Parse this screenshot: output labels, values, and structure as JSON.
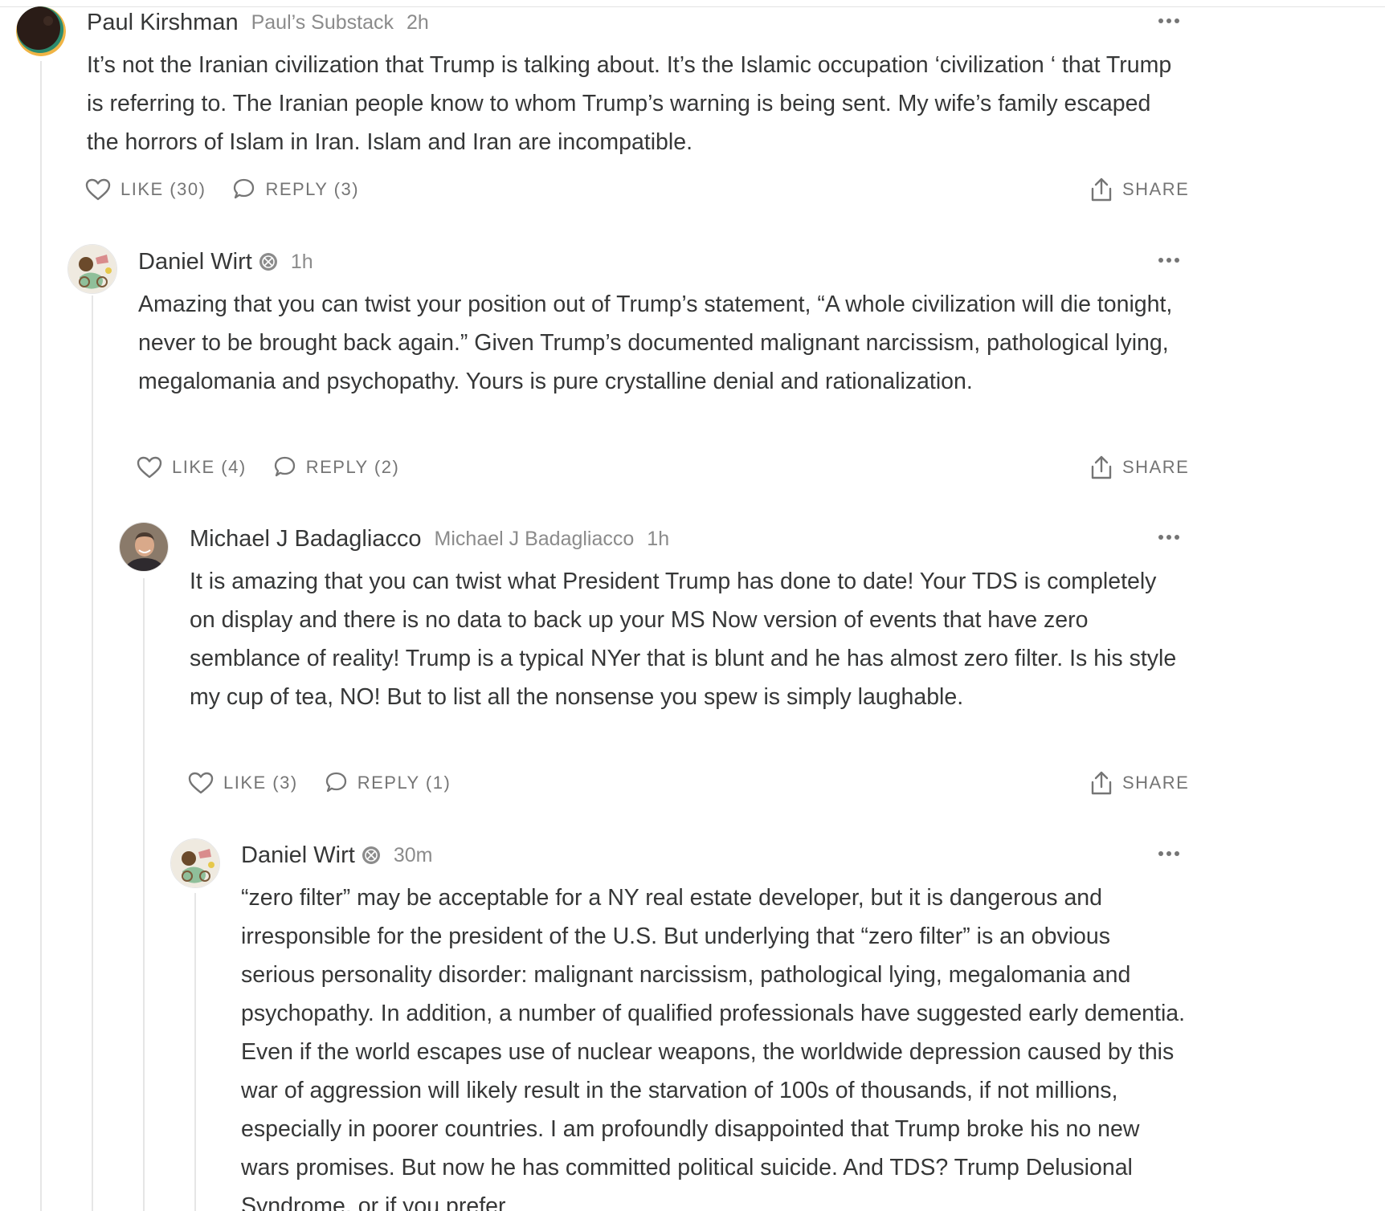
{
  "comments": [
    {
      "author": "Paul Kirshman",
      "publication": "Paul’s Substack",
      "time": "2h",
      "text": "It’s not the Iranian civilization that Trump is talking about. It’s the Islamic occupation ‘civilization ‘ that Trump is referring to. The Iranian people know to whom Trump’s warning is being sent. My wife’s family escaped the horrors of Islam in Iran. Islam and Iran are incompatible.",
      "like_label": "LIKE (30)",
      "reply_label": "REPLY (3)",
      "share_label": "SHARE"
    },
    {
      "author": "Daniel Wirt",
      "time": "1h",
      "text": "Amazing that you can twist your position out of Trump’s statement, “A whole civilization will die tonight, never to be brought back again.” Given Trump’s documented malignant narcissism, pathological lying, megalomania and psychopathy. Yours is pure crystalline denial and rationalization.",
      "like_label": "LIKE (4)",
      "reply_label": "REPLY (2)",
      "share_label": "SHARE"
    },
    {
      "author": "Michael J Badagliacco",
      "publication": "Michael J Badagliacco",
      "time": "1h",
      "text": "It is amazing that you can twist what President Trump has done to date! Your TDS is completely on display and there is no data to back up your MS Now version of events that have zero semblance of reality! Trump is a typical NYer that is blunt and he has almost zero filter. Is his style my cup of tea, NO! But to list all the nonsense you spew is simply laughable.",
      "like_label": "LIKE (3)",
      "reply_label": "REPLY (1)",
      "share_label": "SHARE"
    },
    {
      "author": "Daniel Wirt",
      "time": "30m",
      "text": "“zero filter” may be acceptable for a NY real estate developer, but it is dangerous and irresponsible for the president of the U.S. But underlying that “zero filter” is an obvious serious personality disorder: malignant narcissism, pathological lying, megalomania and psychopathy. In addition, a number of qualified professionals have suggested early dementia. Even if the world escapes use of nuclear weapons, the worldwide depression caused by this war of aggression will likely result in the starvation of 100s of thousands, if not millions, especially in poorer countries. I am profoundly disappointed that Trump broke his no new wars promises. But now he has committed political suicide. And TDS? Trump Delusional Syndrome, or if you prefer"
    }
  ],
  "colors": {
    "text": "#363737",
    "meta": "#8b8b8b",
    "action": "#757575",
    "thread_line": "#e6e6e6"
  }
}
